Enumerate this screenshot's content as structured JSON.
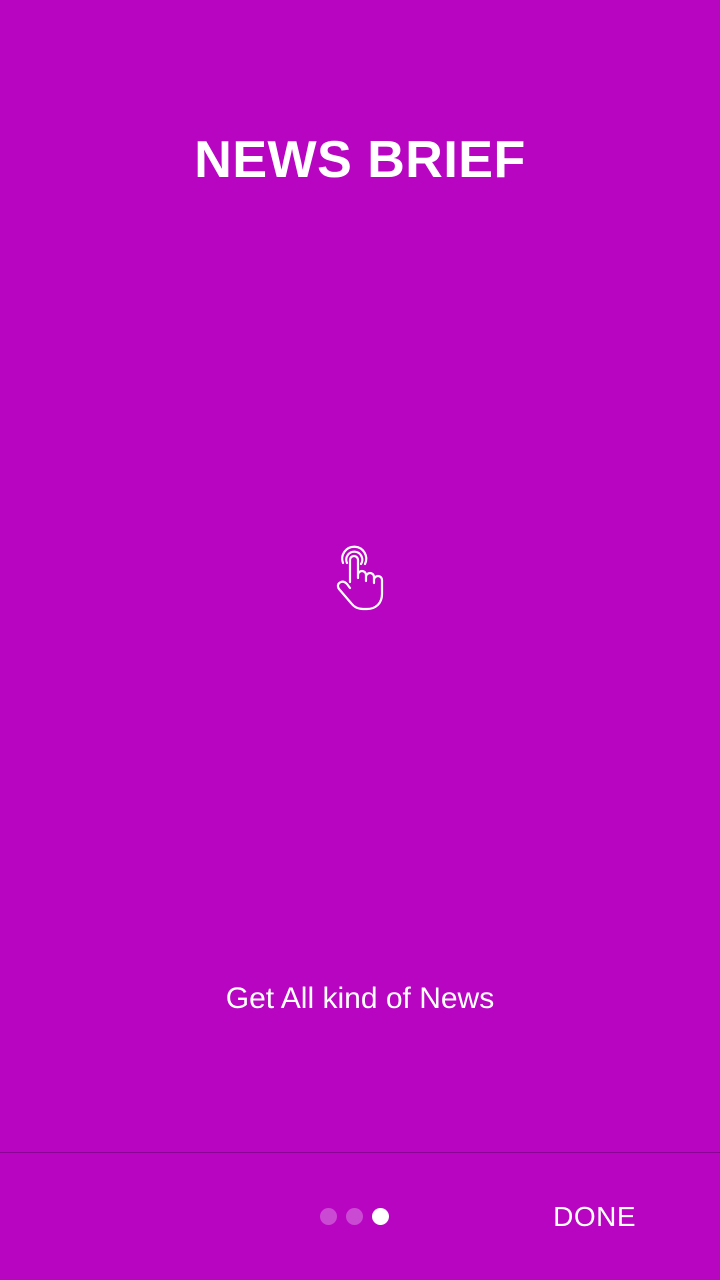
{
  "theme": {
    "background": "#b805c2",
    "text": "#ffffff"
  },
  "slide": {
    "title": "NEWS BRIEF",
    "icon": "touch-hand-icon",
    "caption": "Get All kind of News"
  },
  "pager": {
    "total": 3,
    "current": 3
  },
  "footer": {
    "done_label": "DONE"
  }
}
